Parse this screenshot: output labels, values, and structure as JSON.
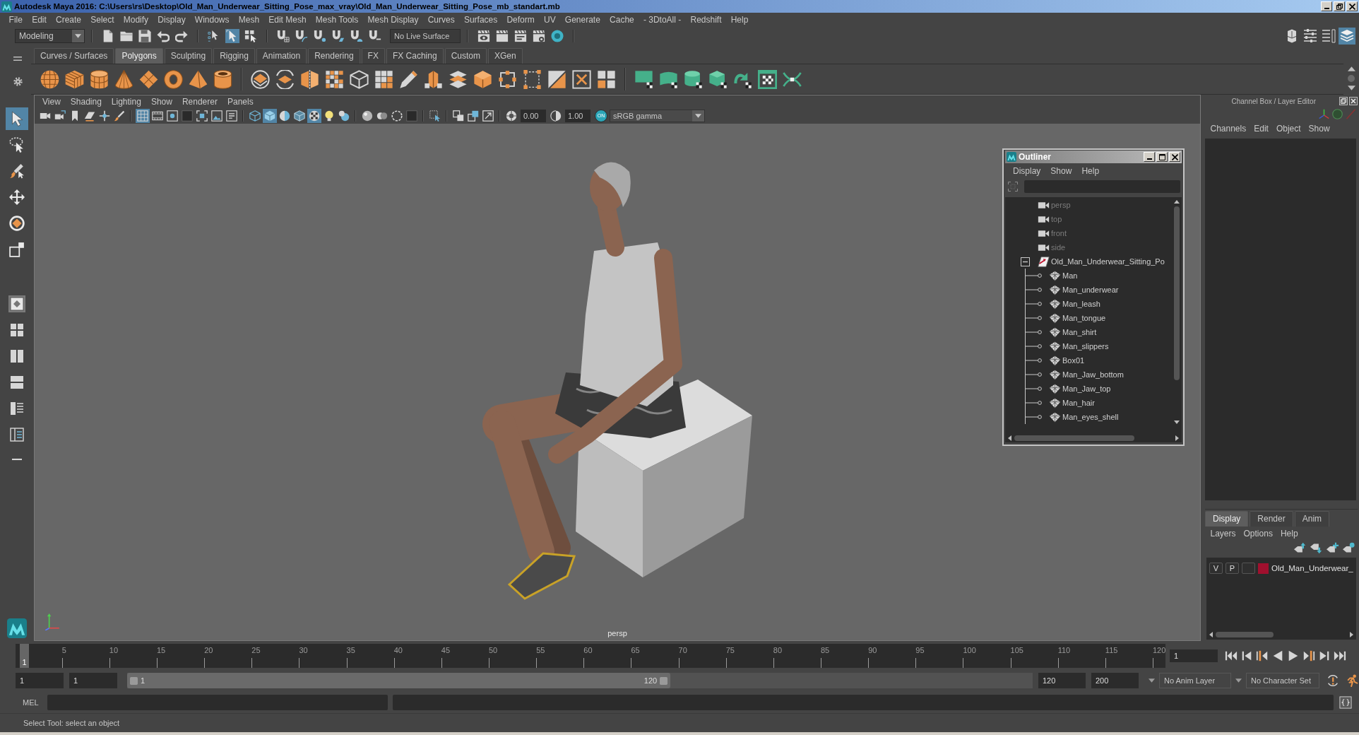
{
  "window": {
    "title": "Autodesk Maya 2016: C:\\Users\\rs\\Desktop\\Old_Man_Underwear_Sitting_Pose_max_vray\\Old_Man_Underwear_Sitting_Pose_mb_standart.mb"
  },
  "menu_bar": [
    "File",
    "Edit",
    "Create",
    "Select",
    "Modify",
    "Display",
    "Windows",
    "Mesh",
    "Edit Mesh",
    "Mesh Tools",
    "Mesh Display",
    "Curves",
    "Surfaces",
    "Deform",
    "UV",
    "Generate",
    "Cache",
    "- 3DtoAll -",
    "Redshift",
    "Help"
  ],
  "status_line": {
    "workspace": "Modeling",
    "select_modes": [
      {
        "selected": false
      },
      {
        "selected": true
      },
      {
        "selected": false
      }
    ],
    "live_surface": "No Live Surface",
    "panel_toggles": [
      {
        "on": false
      },
      {
        "on": false
      },
      {
        "on": false
      },
      {
        "on": true
      }
    ]
  },
  "shelf": {
    "tabs": [
      {
        "label": "Curves / Surfaces",
        "selected": false
      },
      {
        "label": "Polygons",
        "selected": true
      },
      {
        "label": "Sculpting",
        "selected": false
      },
      {
        "label": "Rigging",
        "selected": false
      },
      {
        "label": "Animation",
        "selected": false
      },
      {
        "label": "Rendering",
        "selected": false
      },
      {
        "label": "FX",
        "selected": false
      },
      {
        "label": "FX Caching",
        "selected": false
      },
      {
        "label": "Custom",
        "selected": false
      },
      {
        "label": "XGen",
        "selected": false
      }
    ]
  },
  "toolbox": {
    "tools": [
      {
        "selected": true
      },
      {
        "selected": false
      },
      {
        "selected": false
      },
      {
        "selected": false
      },
      {
        "selected": false
      },
      {
        "selected": false
      }
    ],
    "layouts": [
      {
        "selected": true
      },
      {
        "selected": false
      },
      {
        "selected": false
      },
      {
        "selected": false
      },
      {
        "selected": false
      },
      {
        "selected": false
      },
      {
        "selected": false
      }
    ]
  },
  "viewport": {
    "menu": [
      "View",
      "Shading",
      "Lighting",
      "Show",
      "Renderer",
      "Panels"
    ],
    "toggles": [
      {
        "on": false
      },
      {
        "on": false
      },
      {
        "on": false
      },
      {
        "on": false
      },
      {
        "on": false
      },
      {
        "on": false
      },
      {
        "on": true
      },
      {
        "on": false
      },
      {
        "on": false
      },
      {
        "on": false
      },
      {
        "on": false
      },
      {
        "on": false
      },
      {
        "on": false
      },
      {
        "on": false
      },
      {
        "on": true
      },
      {
        "on": false
      },
      {
        "on": false
      },
      {
        "on": true
      },
      {
        "on": false
      },
      {
        "on": false
      },
      {
        "on": false
      },
      {
        "on": false
      },
      {
        "on": false
      },
      {
        "on": false
      },
      {
        "on": false
      },
      {
        "on": false
      },
      {
        "on": false
      },
      {
        "on": false
      }
    ],
    "exposure": "0.00",
    "gamma": "1.00",
    "color_management": {
      "label": "ON",
      "on": true
    },
    "view_transform": "sRGB gamma",
    "camera": "persp"
  },
  "outliner": {
    "title": "Outliner",
    "menu": [
      "Display",
      "Show",
      "Help"
    ],
    "items": [
      {
        "label": "persp",
        "kind": "camera",
        "dimmed": true
      },
      {
        "label": "top",
        "kind": "camera",
        "dimmed": true
      },
      {
        "label": "front",
        "kind": "camera",
        "dimmed": true
      },
      {
        "label": "side",
        "kind": "camera",
        "dimmed": true
      },
      {
        "label": "Old_Man_Underwear_Sitting_Po",
        "kind": "group",
        "dimmed": false,
        "expanded": true,
        "children": [
          {
            "label": "Man",
            "kind": "mesh",
            "dimmed": false
          },
          {
            "label": "Man_underwear",
            "kind": "mesh",
            "dimmed": false
          },
          {
            "label": "Man_leash",
            "kind": "mesh",
            "dimmed": false
          },
          {
            "label": "Man_tongue",
            "kind": "mesh",
            "dimmed": false
          },
          {
            "label": "Man_shirt",
            "kind": "mesh",
            "dimmed": false
          },
          {
            "label": "Man_slippers",
            "kind": "mesh",
            "dimmed": false
          },
          {
            "label": "Box01",
            "kind": "mesh",
            "dimmed": false
          },
          {
            "label": "Man_Jaw_bottom",
            "kind": "mesh",
            "dimmed": false
          },
          {
            "label": "Man_Jaw_top",
            "kind": "mesh",
            "dimmed": false
          },
          {
            "label": "Man_hair",
            "kind": "mesh",
            "dimmed": false
          },
          {
            "label": "Man_eyes_shell",
            "kind": "mesh",
            "dimmed": false
          }
        ]
      }
    ]
  },
  "channel_box": {
    "title": "Channel Box / Layer Editor",
    "menu": [
      "Channels",
      "Edit",
      "Object",
      "Show"
    ]
  },
  "layer_editor": {
    "tabs": [
      {
        "label": "Display",
        "selected": true
      },
      {
        "label": "Render",
        "selected": false
      },
      {
        "label": "Anim",
        "selected": false
      }
    ],
    "menu": [
      "Layers",
      "Options",
      "Help"
    ],
    "layers": [
      {
        "visibility": "V",
        "playback": "P",
        "name": "Old_Man_Underwear_",
        "color": "#a0102e"
      }
    ]
  },
  "time_slider": {
    "ticks": [
      "5",
      "10",
      "15",
      "20",
      "25",
      "30",
      "35",
      "40",
      "45",
      "50",
      "55",
      "60",
      "65",
      "70",
      "75",
      "80",
      "85",
      "90",
      "95",
      "100",
      "105",
      "110",
      "115",
      "120"
    ],
    "current_frame": "1",
    "level": 0,
    "frame_field": "1"
  },
  "range_slider": {
    "start_field": "1",
    "playback_start_field": "1",
    "range_start": "1",
    "range_end": "120",
    "level": 0.6,
    "playback_end_field": "120",
    "end_field": "200",
    "anim_layer": "No Anim Layer",
    "character_set": "No Character Set"
  },
  "command_line": {
    "language": "MEL"
  },
  "help_line": {
    "text": "Select Tool: select an object"
  }
}
